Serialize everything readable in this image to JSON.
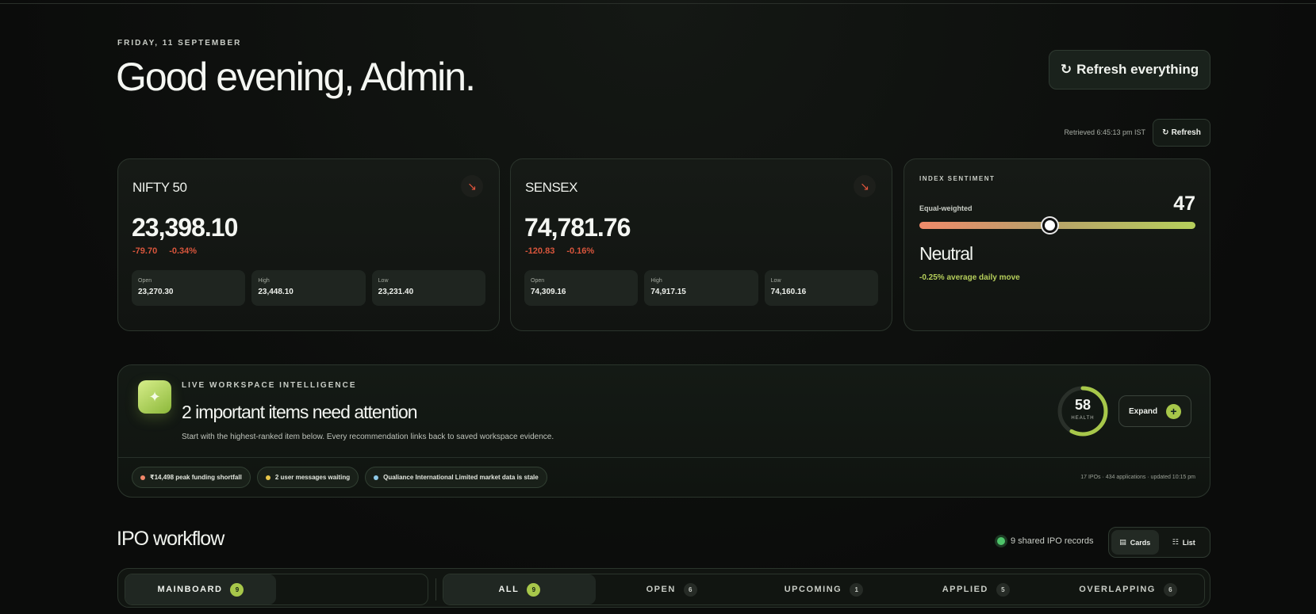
{
  "header": {
    "date": "FRIDAY, 11 SEPTEMBER",
    "greeting": "Good evening, Admin.",
    "refresh_all_label": "Refresh everything",
    "retrieved": "Retrieved 6:45:13 pm IST",
    "refresh_label": "Refresh"
  },
  "indices": [
    {
      "name": "NIFTY 50",
      "value": "23,398.10",
      "change": "-79.70",
      "change_pct": "-0.34%",
      "open_label": "Open",
      "open": "23,270.30",
      "high_label": "High",
      "high": "23,448.10",
      "low_label": "Low",
      "low": "23,231.40"
    },
    {
      "name": "SENSEX",
      "value": "74,781.76",
      "change": "-120.83",
      "change_pct": "-0.16%",
      "open_label": "Open",
      "open": "74,309.16",
      "high_label": "High",
      "high": "74,917.15",
      "low_label": "Low",
      "low": "74,160.16"
    }
  ],
  "sentiment": {
    "heading": "INDEX SENTIMENT",
    "sub": "Equal-weighted",
    "score": "47",
    "score_value": 47,
    "mood": "Neutral",
    "move": "-0.25% average daily move"
  },
  "intel": {
    "kicker": "LIVE WORKSPACE INTELLIGENCE",
    "title": "2 important items need attention",
    "desc": "Start with the highest-ranked item below. Every recommendation links back to saved workspace evidence.",
    "health_value": "58",
    "health_score": 58,
    "health_label": "HEALTH",
    "expand_label": "Expand",
    "chips": [
      {
        "text": "₹14,498 peak funding shortfall",
        "color": "#f0876a"
      },
      {
        "text": "2 user messages waiting",
        "color": "#e8c64a"
      },
      {
        "text": "Qualiance International Limited market data is stale",
        "color": "#8ec9e8"
      }
    ],
    "meta": "17 IPOs · 434 applications · updated 10:15 pm"
  },
  "ipo": {
    "title": "IPO workflow",
    "shared": "9 shared IPO records",
    "view_cards": "Cards",
    "view_list": "List",
    "segment": {
      "label": "MAINBOARD",
      "count": "9"
    },
    "tabs": [
      {
        "label": "ALL",
        "count": "9"
      },
      {
        "label": "OPEN",
        "count": "6"
      },
      {
        "label": "UPCOMING",
        "count": "1"
      },
      {
        "label": "APPLIED",
        "count": "5"
      },
      {
        "label": "OVERLAPPING",
        "count": "6"
      }
    ]
  },
  "colors": {
    "accent": "#a7c74a",
    "negative": "#d8553c",
    "bg": "#0d0f0d"
  }
}
